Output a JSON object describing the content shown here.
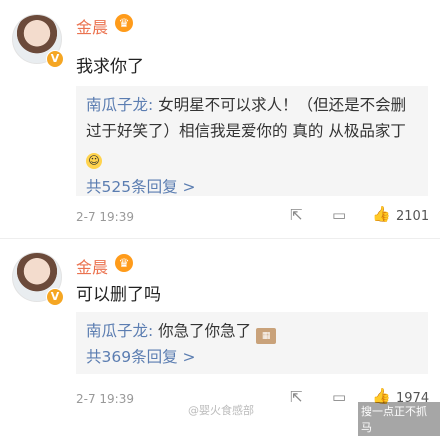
{
  "colors": {
    "name": "#eb7350",
    "link": "#5b7db1",
    "quote_bg": "#f5f5f5"
  },
  "comments": [
    {
      "author": "金晨",
      "badge_icon": "crown-icon",
      "verified_icon": "v-verified-icon",
      "text": "我求你了",
      "reply_author": "南瓜子龙:",
      "reply_text_1": "女明星不可以求人！（但还是不会删 过于好笑了）相信我是爱你的 真的 从极品家丁",
      "reply_emoji": "smile-emoji",
      "more_replies": "共525条回复 >",
      "time": "2-7 19:39",
      "likes": "2101"
    },
    {
      "author": "金晨",
      "badge_icon": "crown-icon",
      "verified_icon": "v-verified-icon",
      "text": "可以删了吗",
      "reply_author": "南瓜子龙:",
      "reply_text_1": "你急了你急了",
      "reply_emoji": "sticker-emoji",
      "more_replies": "共369条回复 >",
      "time": "2-7 19:39",
      "likes": "1974"
    }
  ],
  "watermark": "@婴火食感部",
  "watermark2": "搜一点正不抓马"
}
